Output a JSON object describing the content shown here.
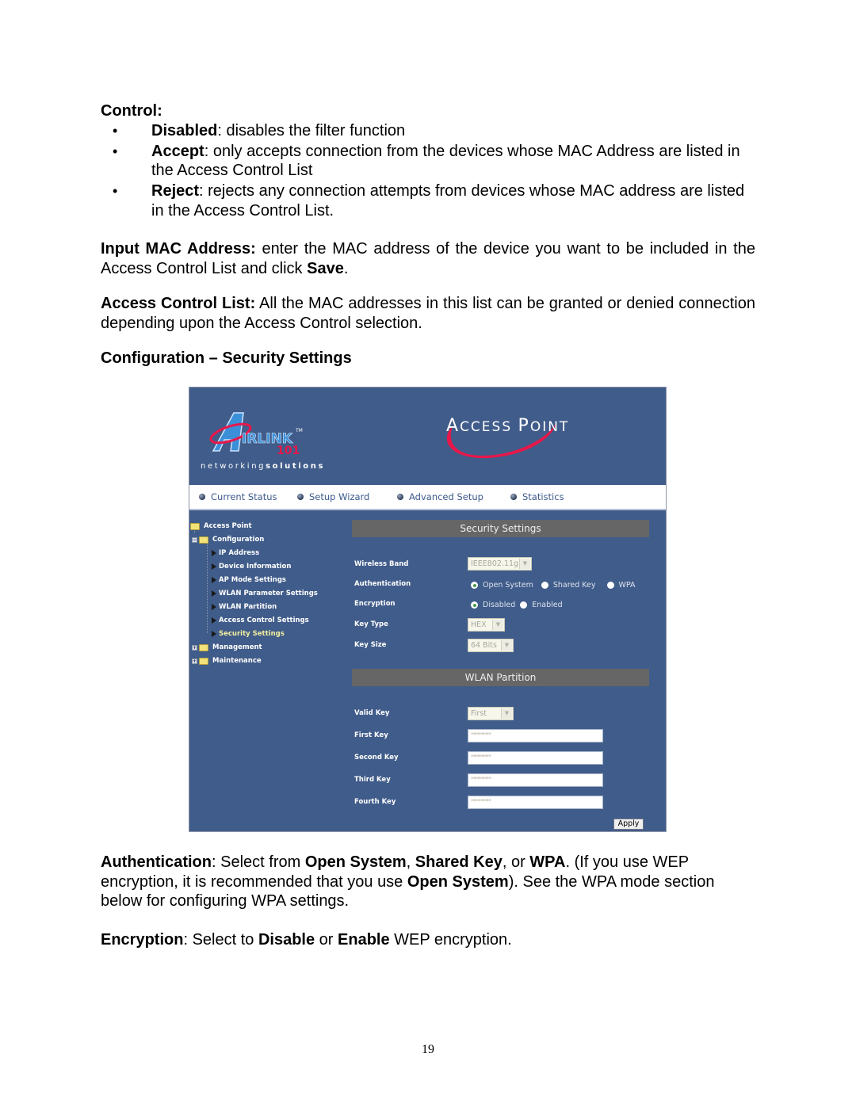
{
  "doc": {
    "control_heading": "Control:",
    "bullets": [
      {
        "term": "Disabled",
        "text": ": disables the filter function"
      },
      {
        "term": "Accept",
        "text": ": only accepts connection from the devices whose MAC Address are listed in the Access Control List"
      },
      {
        "term": "Reject",
        "text": ": rejects any connection attempts from devices whose MAC address are listed in the Access Control List."
      }
    ],
    "input_mac": {
      "term": "Input MAC Address:",
      "text1": " enter the MAC address of the device you want to be included in the Access Control List and click ",
      "save": "Save",
      "text2": "."
    },
    "acl": {
      "term": "Access Control List:",
      "text": " All the MAC addresses in this list can be granted or denied connection depending upon the Access Control selection."
    },
    "section_heading": "Configuration – Security Settings",
    "auth_para": {
      "term": "Authentication",
      "t1": ": Select from ",
      "b1": "Open System",
      "t2": ", ",
      "b2": "Shared Key",
      "t3": ", or ",
      "b3": "WPA",
      "t4": ". (If you use WEP encryption, it is recommended that you use ",
      "b4": "Open System",
      "t5": "). See the WPA mode section below for configuring WPA settings."
    },
    "enc_para": {
      "term": "Encryption",
      "t1": ": Select to ",
      "b1": "Disable",
      "t2": " or ",
      "b2": "Enable",
      "t3": " WEP encryption."
    },
    "page_number": "19"
  },
  "screenshot": {
    "brand": {
      "logo_main": "AIRLINK",
      "logo_sub": "101",
      "tm": "TM",
      "tagline_light": "networking",
      "tagline_bold": "solutions",
      "product_title_A": "A",
      "product_title_rest1": "CCESS ",
      "product_title_P": "P",
      "product_title_rest2": "OINT"
    },
    "nav": [
      "Current Status",
      "Setup Wizard",
      "Advanced Setup",
      "Statistics"
    ],
    "tree": {
      "root": "Access Point",
      "configuration": "Configuration",
      "children": [
        "IP Address",
        "Device Information",
        "AP Mode Settings",
        "WLAN Parameter Settings",
        "WLAN Partition",
        "Access Control Settings",
        "Security Settings"
      ],
      "active_child": "Security Settings",
      "management": "Management",
      "maintenance": "Maintenance"
    },
    "security_section": {
      "title": "Security Settings",
      "wireless_band_label": "Wireless Band",
      "wireless_band_value": "IEEE802.11g",
      "authentication_label": "Authentication",
      "authentication_options": [
        "Open System",
        "Shared Key",
        "WPA"
      ],
      "authentication_selected": "Open System",
      "encryption_label": "Encryption",
      "encryption_options": [
        "Disabled",
        "Enabled"
      ],
      "encryption_selected": "Disabled",
      "key_type_label": "Key Type",
      "key_type_value": "HEX",
      "key_size_label": "Key Size",
      "key_size_value": "64 Bits"
    },
    "partition_section": {
      "title": "WLAN Partition",
      "valid_key_label": "Valid Key",
      "valid_key_value": "First",
      "keys": [
        {
          "label": "First Key",
          "value": "**********"
        },
        {
          "label": "Second Key",
          "value": "**********"
        },
        {
          "label": "Third Key",
          "value": "**********"
        },
        {
          "label": "Fourth Key",
          "value": "**********"
        }
      ],
      "apply_label": "Apply"
    },
    "colors": {
      "background": "#405c8a",
      "section_bar": "#666666",
      "accent_red": "#e8174a",
      "active_tree": "#f3ef9e"
    }
  }
}
